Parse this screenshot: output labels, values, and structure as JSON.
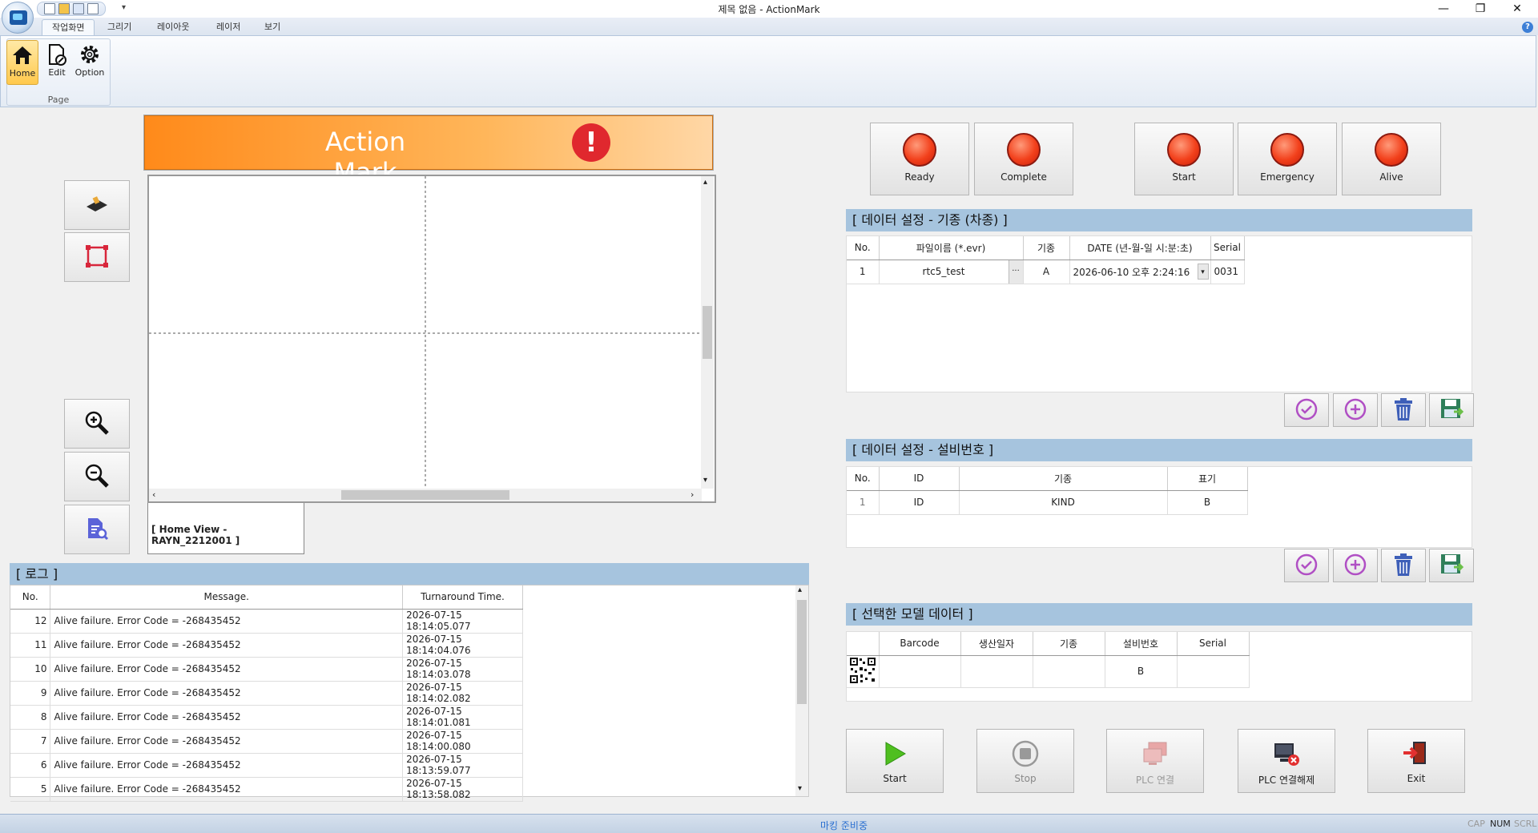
{
  "window": {
    "title": "제목 없음 - ActionMark",
    "minimize": "—",
    "restore": "❐",
    "close": "✕"
  },
  "ribbon": {
    "tabs": [
      "작업화면",
      "그리기",
      "레이아웃",
      "레이저",
      "보기"
    ],
    "qat_dropdown": "▾",
    "help": "?",
    "page_group": {
      "label": "Page",
      "buttons": [
        {
          "label": "Home",
          "icon": "home-icon"
        },
        {
          "label": "Edit",
          "icon": "edit-document-icon"
        },
        {
          "label": "Option",
          "icon": "gear-icon"
        }
      ]
    }
  },
  "banner": {
    "title": "Action Mark",
    "alert_glyph": "!"
  },
  "canvas": {
    "view_tab": "[  Home View - RAYN_2212001  ]"
  },
  "log": {
    "header": "[ 로그 ]",
    "columns": [
      "No.",
      "Message.",
      "Turnaround Time."
    ],
    "rows": [
      [
        "12",
        "Alive failure. Error Code = -268435452",
        "2026-07-15 18:14:05.077"
      ],
      [
        "11",
        "Alive failure. Error Code = -268435452",
        "2026-07-15 18:14:04.076"
      ],
      [
        "10",
        "Alive failure. Error Code = -268435452",
        "2026-07-15 18:14:03.078"
      ],
      [
        "9",
        "Alive failure. Error Code = -268435452",
        "2026-07-15 18:14:02.082"
      ],
      [
        "8",
        "Alive failure. Error Code = -268435452",
        "2026-07-15 18:14:01.081"
      ],
      [
        "7",
        "Alive failure. Error Code = -268435452",
        "2026-07-15 18:14:00.080"
      ],
      [
        "6",
        "Alive failure. Error Code = -268435452",
        "2026-07-15 18:13:59.077"
      ],
      [
        "5",
        "Alive failure. Error Code = -268435452",
        "2026-07-15 18:13:58.082"
      ]
    ]
  },
  "status_lamps": [
    "Ready",
    "Complete",
    "Start",
    "Emergency",
    "Alive"
  ],
  "model_settings": {
    "header": "[ 데이터 설정 - 기종 (차종) ]",
    "columns": [
      "No.",
      "파일이름 (*.evr)",
      "기종",
      "DATE (년-월-일 시:분:초)",
      "Serial"
    ],
    "row": {
      "no": "1",
      "file": "rtc5_test",
      "browse": "...",
      "kind": "A",
      "date": "2026-06-10  오후 2:24:16",
      "serial": "0031"
    }
  },
  "equipment_settings": {
    "header": "[ 데이터 설정 - 설비번호 ]",
    "columns": [
      "No.",
      "ID",
      "기종",
      "표기"
    ],
    "row": {
      "no": "1",
      "id": "ID",
      "kind": "KIND",
      "mark": "B"
    }
  },
  "selected_model": {
    "header": "[ 선택한 모델 데이터 ]",
    "columns": [
      "",
      "Barcode",
      "생산일자",
      "기종",
      "설비번호",
      "Serial"
    ],
    "row": {
      "barcode": "",
      "date": "",
      "kind": "",
      "equip": "B",
      "serial": ""
    }
  },
  "actions": {
    "start": "Start",
    "stop": "Stop",
    "plc_connect": "PLC 연결",
    "plc_disconnect": "PLC 연결해제",
    "exit": "Exit"
  },
  "statusbar": {
    "message": "마킹 준비중",
    "cap": "CAP",
    "num": "NUM",
    "scrl": "SCRL"
  },
  "colors": {
    "accent_orange": "#ff8a1a",
    "lamp_red": "#f2401b",
    "section_header": "#a6c4de",
    "icon_purple": "#b04fc4"
  }
}
